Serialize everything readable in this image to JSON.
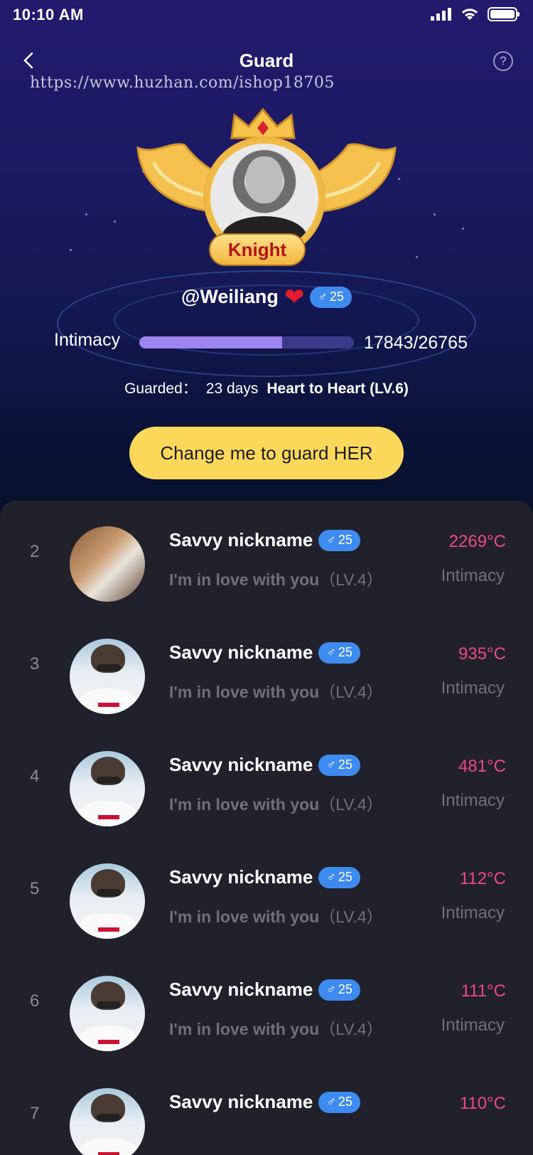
{
  "status_bar": {
    "time": "10:10 AM"
  },
  "nav": {
    "title": "Guard",
    "help": "?"
  },
  "watermark": "https://www.huzhan.com/ishop18705",
  "guard": {
    "rank": "Knight",
    "username": "@Weiliang",
    "age": "25",
    "gender_symbol": "♂",
    "intimacy_label": "Intimacy",
    "intimacy_value": "17843/26765",
    "intimacy_progress": 0.667,
    "guarded_label": "Guarded：",
    "guarded_days": "23 days",
    "level_text": "Heart to Heart (LV.6)"
  },
  "cta_label": "Change me to guard HER",
  "colors": {
    "accent_yellow": "#fbd85a",
    "temperature_pink": "#ef4a7b",
    "age_badge_blue": "#3e8bf0",
    "progress_fill": "#9d83f0"
  },
  "list": [
    {
      "rank": "2",
      "nickname": "Savvy nickname",
      "age": "25",
      "bio": "I'm in love with you",
      "level": "（LV.4）",
      "temperature": "2269°C",
      "stat_label": "Intimacy"
    },
    {
      "rank": "3",
      "nickname": "Savvy nickname",
      "age": "25",
      "bio": "I'm in love with you",
      "level": "（LV.4）",
      "temperature": "935°C",
      "stat_label": "Intimacy"
    },
    {
      "rank": "4",
      "nickname": "Savvy nickname",
      "age": "25",
      "bio": "I'm in love with you",
      "level": "（LV.4）",
      "temperature": "481°C",
      "stat_label": "Intimacy"
    },
    {
      "rank": "5",
      "nickname": "Savvy nickname",
      "age": "25",
      "bio": "I'm in love with you",
      "level": "（LV.4）",
      "temperature": "112°C",
      "stat_label": "Intimacy"
    },
    {
      "rank": "6",
      "nickname": "Savvy nickname",
      "age": "25",
      "bio": "I'm in love with you",
      "level": "（LV.4）",
      "temperature": "111°C",
      "stat_label": "Intimacy"
    },
    {
      "rank": "7",
      "nickname": "Savvy nickname",
      "age": "25",
      "bio": "",
      "level": "",
      "temperature": "110°C",
      "stat_label": ""
    }
  ]
}
